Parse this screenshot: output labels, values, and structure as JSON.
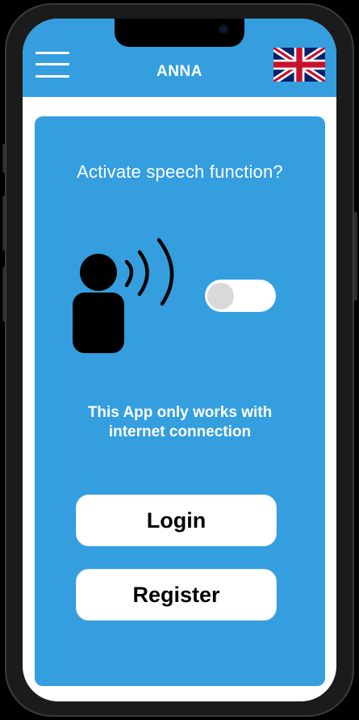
{
  "header": {
    "title": "ANNA",
    "menu_icon": "hamburger-menu-icon",
    "language_icon": "uk-flag-icon",
    "background_color": "#349edf"
  },
  "speech": {
    "question": "Activate speech function?",
    "illustration_icon": "person-speaking-icon",
    "toggle_enabled": false
  },
  "notice": {
    "line1": "This App only works with",
    "line2": "internet connection"
  },
  "actions": {
    "login_label": "Login",
    "register_label": "Register"
  },
  "colors": {
    "accent": "#349edf",
    "button_background": "#ffffff",
    "toggle_knob": "#d9d9d9"
  }
}
